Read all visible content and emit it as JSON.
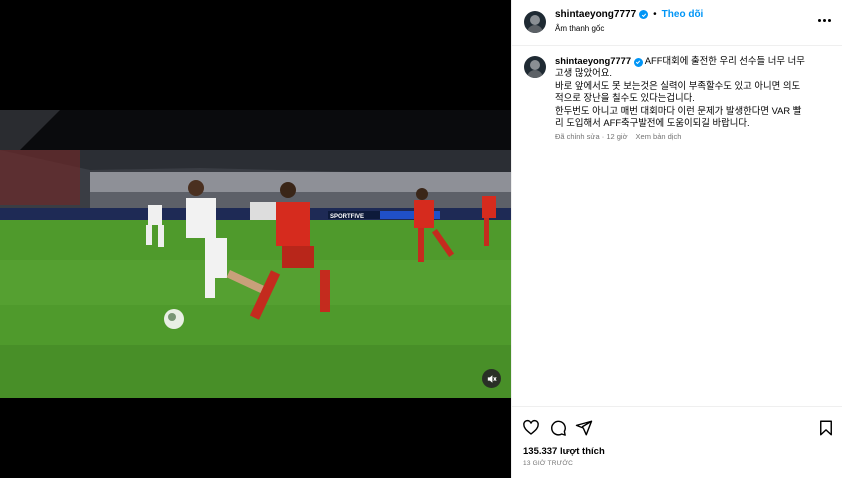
{
  "post": {
    "username": "shintaeyong7777",
    "follow_label": "Theo dõi",
    "separator": "•",
    "audio_label": "Âm thanh gốc",
    "caption_lines": [
      "AFF대회에 출전한 우리 선수들 너무 너무",
      "고생 많았어요.",
      "바로 앞에서도 못 보는것은 실력이 부족할수도 있고 아니면 의도",
      "적으로 장난을 칠수도 있다는겁니다.",
      "한두번도 아니고 매번 대회마다 이런 문제가 발생한다면 VAR 빨",
      "리 도입해서 AFF축구발전에 도움이되길 바랍니다."
    ],
    "edited_label": "Đã chỉnh sửa",
    "edited_time": "12 giờ",
    "meta_separator": "·",
    "translate_label": "Xem bản dịch",
    "likes": "135.337 lượt thích",
    "time_ago": "13 GIỜ TRƯỚC"
  },
  "icons": {
    "verified": "verified-badge-icon",
    "more": "more-options-icon",
    "like": "heart-icon",
    "comment": "comment-icon",
    "share": "share-icon",
    "save": "bookmark-icon",
    "mute": "speaker-muted-icon"
  },
  "video": {
    "board_text": "SPORTFIVE"
  },
  "colors": {
    "accent": "#0095f6",
    "pitch": "#4f9a2c",
    "home_kit": "#d62b1e",
    "away_kit": "#f2f2f2"
  }
}
